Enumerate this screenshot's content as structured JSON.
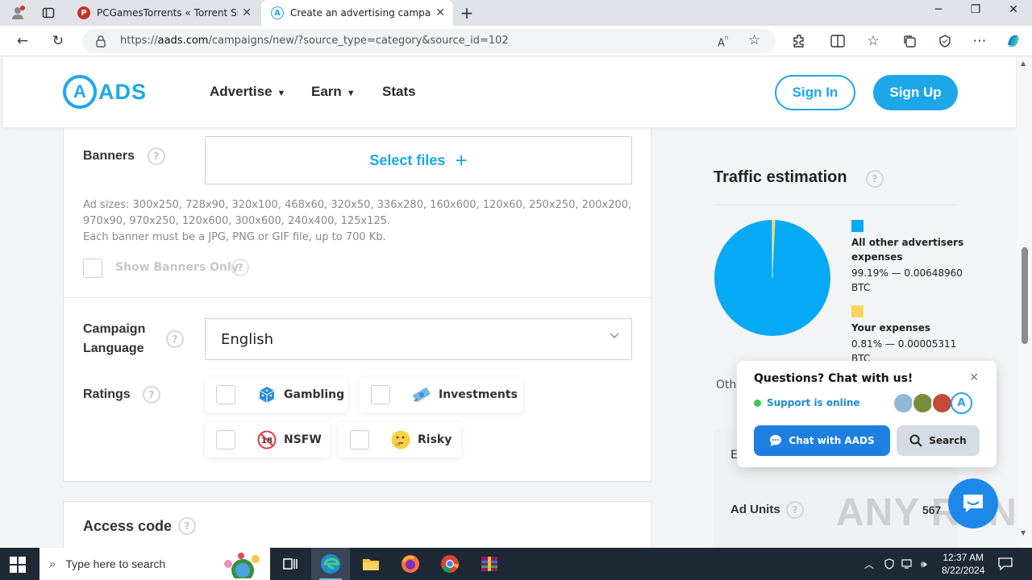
{
  "browser": {
    "tabs": [
      {
        "title": "PCGamesTorrents « Torrent Site f",
        "active": false
      },
      {
        "title": "Create an advertising campaign",
        "active": true
      }
    ],
    "url_prefix": "https://",
    "url_domain": "aads.com",
    "url_path": "/campaigns/new/?source_type=category&source_id=102",
    "new_tab_icon": "+"
  },
  "site": {
    "logo_text": "ADS",
    "logo_letter": "A",
    "nav": {
      "advertise": "Advertise",
      "earn": "Earn",
      "stats": "Stats"
    },
    "sign_in": "Sign In",
    "sign_up": "Sign Up"
  },
  "form": {
    "banners_label": "Banners",
    "select_files": "Select files",
    "ad_sizes": "Ad sizes: 300x250, 728x90, 320x100, 468x60, 320x50, 336x280, 160x600, 120x60, 250x250, 200x200, 970x90, 970x250, 120x600, 300x600, 240x400, 125x125.",
    "banner_rule": "Each banner must be a JPG, PNG or GIF file, up to 700 Kb.",
    "show_banners_only": "Show Banners Only",
    "campaign_language_label_1": "Campaign",
    "campaign_language_label_2": "Language",
    "language_value": "English",
    "ratings_label": "Ratings",
    "ratings": [
      "Gambling",
      "Investments",
      "NSFW",
      "Risky"
    ],
    "access_code_label": "Access code"
  },
  "traffic": {
    "title": "Traffic estimation",
    "other_label": "All other advertisers expenses",
    "other_value": "99.19% — 0.00648960 BTC",
    "yours_label": "Your expenses",
    "yours_value": "0.81% — 0.00005311 BTC",
    "other_share": 99.19,
    "your_share": 0.81,
    "colors": {
      "other": "#06a9f4",
      "yours": "#fad55c"
    },
    "partial_label": "Oth",
    "partial_row_letter": "E",
    "ad_units_label": "Ad Units",
    "ad_units_value": "567"
  },
  "chat": {
    "title": "Questions? Chat with us!",
    "status": "Support is online",
    "chat_button": "Chat with AADS",
    "search_button": "Search"
  },
  "watermark": "ANY RUN",
  "taskbar": {
    "search_placeholder": "Type here to search",
    "time": "12:37 AM",
    "date": "8/22/2024"
  }
}
